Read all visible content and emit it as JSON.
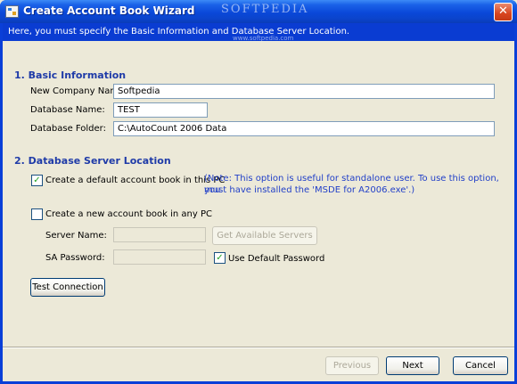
{
  "window": {
    "title": "Create Account Book Wizard",
    "watermark": "SOFTPEDIA",
    "close_glyph": "✕"
  },
  "banner": {
    "instruction": "Here, you must specify the Basic Information and Database Server Location.",
    "watermark_url": "www.softpedia.com"
  },
  "basic_info": {
    "heading": "1. Basic Information",
    "company_label": "New Company Name:",
    "company_value": "Softpedia",
    "dbname_label": "Database Name:",
    "dbname_value": "TEST",
    "folder_label": "Database Folder:",
    "folder_value": "C:\\AutoCount 2006 Data"
  },
  "server": {
    "heading": "2. Database Server Location",
    "default_option": "Create a default account book in this PC",
    "default_checked": true,
    "note_line1": "(Note: This option is useful for standalone user. To use this option, you",
    "note_line2": "must have installed the 'MSDE for A2006.exe'.)",
    "new_option": "Create a new account book in any PC",
    "new_checked": false,
    "server_name_label": "Server Name:",
    "server_name_value": "",
    "get_servers_label": "Get Available Servers",
    "sa_password_label": "SA Password:",
    "sa_password_value": "",
    "use_default_pw_label": "Use Default Password",
    "use_default_pw_checked": true,
    "test_connection_label": "Test Connection"
  },
  "footer": {
    "previous_label": "Previous",
    "next_label": "Next",
    "cancel_label": "Cancel"
  },
  "colors": {
    "titlebar": "#0a48d9",
    "section_heading": "#1f3ba8",
    "note_text": "#2240c8",
    "check_mark": "#21a121"
  }
}
